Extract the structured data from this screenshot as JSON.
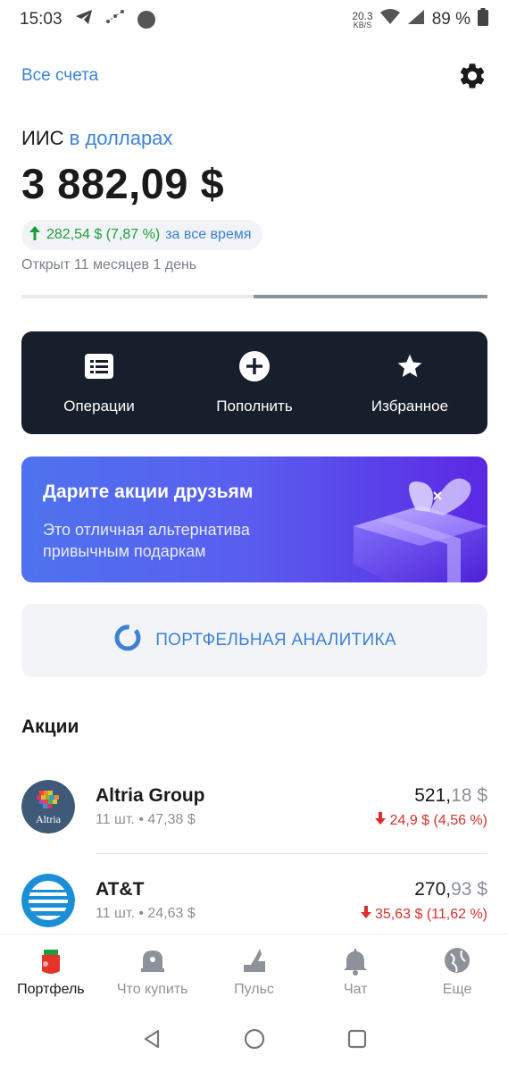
{
  "status_bar": {
    "time": "15:03",
    "net_speed_value": "20.3",
    "net_speed_unit": "KB/S",
    "battery": "89 %"
  },
  "header": {
    "all_accounts_label": "Все счета",
    "settings_icon": "gear-icon"
  },
  "account": {
    "title_prefix": "ИИС",
    "title_suffix": "в долларах",
    "balance": "3 882,09 $",
    "gain_value": "282,54 $ (7,87 %)",
    "gain_period": "за все время",
    "opened_text": "Открыт 11 месяцев 1 день"
  },
  "actions": [
    {
      "label": "Операции",
      "icon": "list-icon"
    },
    {
      "label": "Пополнить",
      "icon": "plus-circle-icon"
    },
    {
      "label": "Избранное",
      "icon": "star-icon"
    }
  ],
  "promo": {
    "title": "Дарите акции друзьям",
    "subtitle": "Это отличная альтернатива привычным подаркам"
  },
  "analytics": {
    "label": "ПОРТФЕЛЬНАЯ АНАЛИТИКА"
  },
  "stocks_section": {
    "title": "Акции",
    "items": [
      {
        "name": "Altria Group",
        "logo_text": "Altria",
        "quantity": "11 шт. • 47,38 $",
        "price_main": "521,",
        "price_decimal": "18 $",
        "change": "24,9 $ (4,56 %)"
      },
      {
        "name": "AT&T",
        "quantity": "11 шт. • 24,63 $",
        "price_main": "270,",
        "price_decimal": "93 $",
        "change": "35,63 $ (11,62 %)"
      }
    ]
  },
  "bottom_nav": [
    {
      "label": "Портфель",
      "icon": "portfolio-icon",
      "active": true
    },
    {
      "label": "Что купить",
      "icon": "what-to-buy-icon",
      "active": false
    },
    {
      "label": "Пульс",
      "icon": "pulse-icon",
      "active": false
    },
    {
      "label": "Чат",
      "icon": "chat-bell-icon",
      "active": false
    },
    {
      "label": "Еще",
      "icon": "more-globe-icon",
      "active": false
    }
  ],
  "colors": {
    "accent_blue": "#3b82d6",
    "gain_green": "#1f9d3a",
    "loss_red": "#d9302b",
    "dark_card": "#171e2c"
  }
}
